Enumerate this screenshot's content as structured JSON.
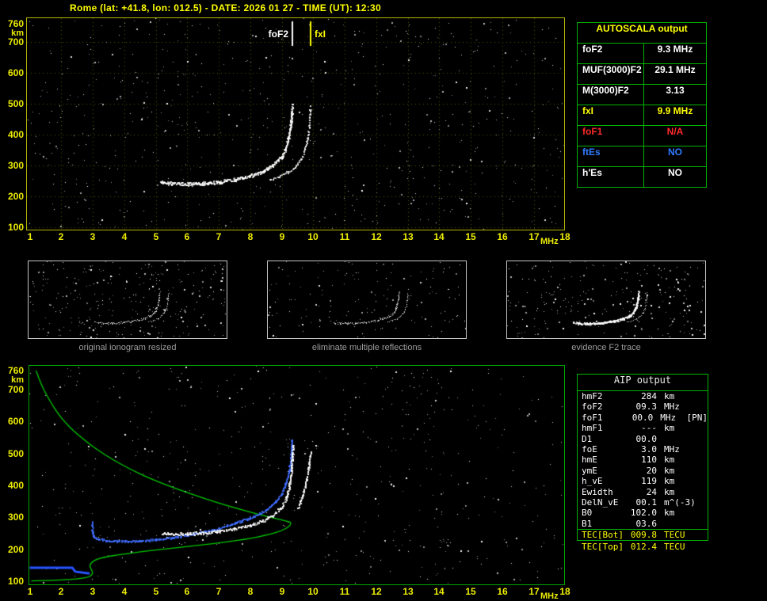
{
  "title": "Rome (lat: +41.8, lon: 012.5) - DATE: 2026 01 27 - TIME (UT): 12:30",
  "top_plot": {
    "foF2_label": "foF2",
    "fxI_label": "fxI"
  },
  "autoscala_table": {
    "header": "AUTOSCALA output",
    "rows": [
      {
        "label": "foF2",
        "value": "9.3 MHz",
        "color": "#ffffff"
      },
      {
        "label": "MUF(3000)F2",
        "value": "29.1 MHz",
        "color": "#ffffff"
      },
      {
        "label": "M(3000)F2",
        "value": "3.13",
        "color": "#ffffff"
      },
      {
        "label": "fxI",
        "value": "9.9 MHz",
        "color": "#ffff00"
      },
      {
        "label": "foF1",
        "value": "N/A",
        "color": "#ff2a2a"
      },
      {
        "label": "ftEs",
        "value": "NO",
        "color": "#2f7bff"
      },
      {
        "label": "h'Es",
        "value": "NO",
        "color": "#ffffff"
      }
    ]
  },
  "thumbnails": [
    {
      "caption": "original ionogram resized"
    },
    {
      "caption": "eliminate multiple reflections"
    },
    {
      "caption": "evidence F2 trace"
    }
  ],
  "aip_table": {
    "header": "AIP output",
    "rows": [
      {
        "name": "hmF2",
        "value": "284",
        "unit": "km",
        "extra": ""
      },
      {
        "name": "foF2",
        "value": "09.3",
        "unit": "MHz",
        "extra": ""
      },
      {
        "name": "foF1",
        "value": "00.0",
        "unit": "MHz",
        "extra": "[PN]"
      },
      {
        "name": "hmF1",
        "value": "---",
        "unit": "km",
        "extra": ""
      },
      {
        "name": "D1",
        "value": "00.0",
        "unit": "",
        "extra": ""
      },
      {
        "name": "foE",
        "value": "3.0",
        "unit": "MHz",
        "extra": ""
      },
      {
        "name": "hmE",
        "value": "110",
        "unit": "km",
        "extra": ""
      },
      {
        "name": "ymE",
        "value": "20",
        "unit": "km",
        "extra": ""
      },
      {
        "name": "h_vE",
        "value": "119",
        "unit": "km",
        "extra": ""
      },
      {
        "name": "Ewidth",
        "value": "24",
        "unit": "km",
        "extra": ""
      },
      {
        "name": "DelN_vE",
        "value": "00.1",
        "unit": "m^(-3)",
        "extra": ""
      },
      {
        "name": "B0",
        "value": "102.0",
        "unit": "km",
        "extra": ""
      },
      {
        "name": "B1",
        "value": "03.6",
        "unit": "",
        "extra": ""
      },
      {
        "name": "TEC[Bot]",
        "value": "009.8",
        "unit": "TECU",
        "extra": "",
        "color": "#ffff00",
        "sep": true
      },
      {
        "name": "TEC[Top]",
        "value": "012.4",
        "unit": "TECU",
        "extra": "",
        "color": "#ffff00",
        "outside": true
      }
    ]
  },
  "chart_data": [
    {
      "id": "main_ionogram",
      "type": "scatter",
      "title": "",
      "xlabel": "MHz",
      "ylabel": "km",
      "xlim": [
        1,
        18
      ],
      "ylim": [
        100,
        760
      ],
      "x_ticks": [
        1,
        2,
        3,
        4,
        5,
        6,
        7,
        8,
        9,
        10,
        11,
        12,
        13,
        14,
        15,
        16,
        17,
        18
      ],
      "y_ticks": [
        100,
        200,
        300,
        400,
        500,
        600,
        700,
        760
      ],
      "grid": true,
      "markers": {
        "foF2_MHz": 9.3,
        "fxI_MHz": 9.9
      },
      "series": [
        {
          "name": "F2 trace O-mode",
          "color": "#ffffff",
          "mode": "band",
          "points": [
            [
              5.15,
              247
            ],
            [
              5.5,
              243
            ],
            [
              6.0,
              241
            ],
            [
              6.5,
              243
            ],
            [
              7.0,
              248
            ],
            [
              7.5,
              256
            ],
            [
              8.0,
              268
            ],
            [
              8.4,
              283
            ],
            [
              8.7,
              302
            ],
            [
              9.0,
              330
            ],
            [
              9.1,
              355
            ],
            [
              9.2,
              390
            ],
            [
              9.27,
              430
            ],
            [
              9.3,
              465
            ],
            [
              9.33,
              497
            ]
          ]
        },
        {
          "name": "F2 trace X-mode",
          "color": "#ffffff",
          "mode": "dots",
          "points": [
            [
              8.6,
              255
            ],
            [
              8.9,
              265
            ],
            [
              9.2,
              280
            ],
            [
              9.45,
              300
            ],
            [
              9.6,
              325
            ],
            [
              9.72,
              355
            ],
            [
              9.8,
              390
            ],
            [
              9.85,
              430
            ],
            [
              9.88,
              465
            ],
            [
              9.9,
              492
            ]
          ]
        }
      ]
    },
    {
      "id": "profile_and_traces",
      "type": "scatter",
      "title": "",
      "xlabel": "MHz",
      "ylabel": "km",
      "xlim": [
        1,
        18
      ],
      "ylim": [
        100,
        760
      ],
      "x_ticks": [
        1,
        2,
        3,
        4,
        5,
        6,
        7,
        8,
        9,
        10,
        11,
        12,
        13,
        14,
        15,
        16,
        17,
        18
      ],
      "y_ticks": [
        100,
        200,
        300,
        400,
        500,
        600,
        700,
        760
      ],
      "grid": false,
      "series": [
        {
          "name": "electron density profile",
          "color": "#00c800",
          "mode": "line",
          "points": [
            [
              1.2,
              760
            ],
            [
              1.35,
              720
            ],
            [
              1.5,
              690
            ],
            [
              1.7,
              655
            ],
            [
              1.9,
              625
            ],
            [
              2.1,
              600
            ],
            [
              2.4,
              570
            ],
            [
              2.7,
              545
            ],
            [
              3.1,
              515
            ],
            [
              3.6,
              483
            ],
            [
              4.2,
              450
            ],
            [
              4.9,
              418
            ],
            [
              5.7,
              388
            ],
            [
              6.6,
              357
            ],
            [
              7.5,
              330
            ],
            [
              8.3,
              308
            ],
            [
              8.9,
              294
            ],
            [
              9.2,
              287
            ],
            [
              9.3,
              284
            ],
            [
              9.25,
              272
            ],
            [
              9.0,
              258
            ],
            [
              8.6,
              246
            ],
            [
              8.0,
              234
            ],
            [
              7.2,
              222
            ],
            [
              6.3,
              212
            ],
            [
              5.4,
              202
            ],
            [
              4.6,
              193
            ],
            [
              3.9,
              184
            ],
            [
              3.4,
              176
            ],
            [
              3.1,
              168
            ],
            [
              2.95,
              158
            ],
            [
              2.9,
              148
            ],
            [
              2.95,
              138
            ],
            [
              3.0,
              128
            ],
            [
              2.97,
              119
            ],
            [
              2.85,
              112
            ],
            [
              2.5,
              107
            ],
            [
              2.0,
              104
            ],
            [
              1.5,
              102
            ],
            [
              1.05,
              101
            ]
          ]
        },
        {
          "name": "restored O-mode trace",
          "color": "#3f6dff",
          "mode": "dots",
          "points": [
            [
              2.97,
              285
            ],
            [
              2.98,
              262
            ],
            [
              3.0,
              244
            ],
            [
              3.1,
              234
            ],
            [
              3.5,
              228
            ],
            [
              4.0,
              227
            ],
            [
              4.5,
              228
            ],
            [
              5.0,
              232
            ],
            [
              5.5,
              238
            ],
            [
              6.0,
              246
            ],
            [
              6.5,
              256
            ],
            [
              7.0,
              268
            ],
            [
              7.5,
              283
            ],
            [
              8.0,
              300
            ],
            [
              8.5,
              325
            ],
            [
              8.8,
              350
            ],
            [
              9.0,
              378
            ],
            [
              9.1,
              405
            ],
            [
              9.2,
              440
            ],
            [
              9.27,
              480
            ],
            [
              9.3,
              520
            ],
            [
              9.31,
              545
            ]
          ]
        },
        {
          "name": "measured F2 trace",
          "color": "#ffffff",
          "mode": "band",
          "points": [
            [
              5.2,
              252
            ],
            [
              5.6,
              250
            ],
            [
              6.0,
              250
            ],
            [
              6.5,
              253
            ],
            [
              7.0,
              258
            ],
            [
              7.5,
              266
            ],
            [
              8.0,
              277
            ],
            [
              8.4,
              291
            ],
            [
              8.7,
              308
            ],
            [
              9.0,
              335
            ],
            [
              9.15,
              368
            ],
            [
              9.25,
              410
            ],
            [
              9.3,
              455
            ],
            [
              9.33,
              497
            ],
            [
              9.35,
              530
            ]
          ]
        },
        {
          "name": "F2 trace X-mode",
          "color": "#ffffff",
          "mode": "dots",
          "points": [
            [
              9.5,
              330
            ],
            [
              9.65,
              370
            ],
            [
              9.78,
              420
            ],
            [
              9.86,
              470
            ],
            [
              9.9,
              505
            ]
          ]
        },
        {
          "name": "E-valley base line",
          "color": "#2753ff",
          "mode": "thickline",
          "points": [
            [
              1.0,
              142
            ],
            [
              2.35,
              142
            ],
            [
              2.45,
              130
            ],
            [
              2.9,
              124
            ]
          ]
        }
      ]
    }
  ]
}
